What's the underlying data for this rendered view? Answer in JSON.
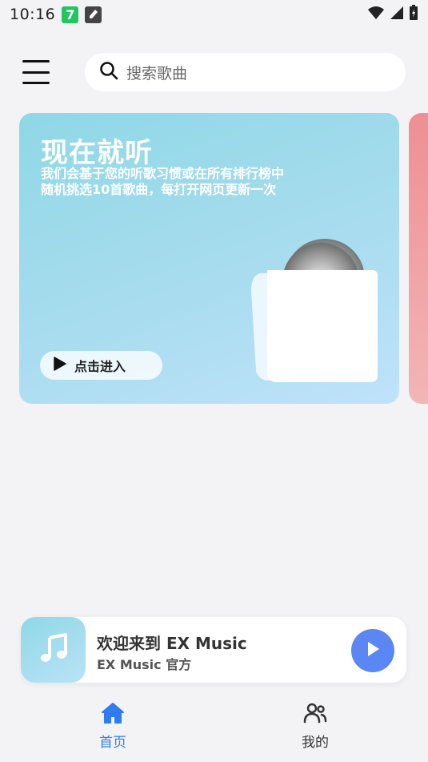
{
  "status_bar": {
    "time": "10:16",
    "app_badge_1": "7"
  },
  "search": {
    "placeholder": "搜索歌曲"
  },
  "banner": {
    "title": "现在就听",
    "description": "我们会基于您的听歌习惯或在所有排行榜中随机挑选10首歌曲，每打开网页更新一次",
    "button_label": "点击进入",
    "colors": {
      "gradient_start": "#8fd8e6",
      "gradient_end": "#bfe2fb",
      "peek": "#ee8f93"
    }
  },
  "mini_player": {
    "title": "欢迎来到 EX Music",
    "subtitle": "EX Music 官方",
    "accent": "#5b87f5"
  },
  "bottom_nav": {
    "items": [
      {
        "label": "首页",
        "icon": "home-icon",
        "active": true
      },
      {
        "label": "我的",
        "icon": "users-icon",
        "active": false
      }
    ],
    "active_color": "#2f7cf0"
  }
}
